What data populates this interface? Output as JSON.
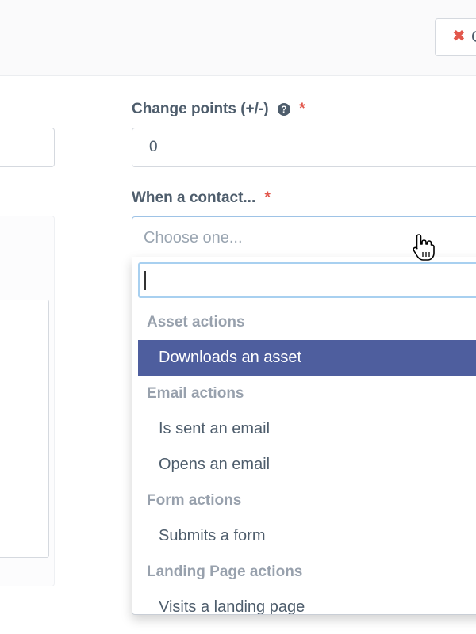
{
  "header": {
    "close_button": {
      "icon": "close-icon",
      "label": "C"
    }
  },
  "form": {
    "points": {
      "label": "Change points (+/-)",
      "help_icon": "question-circle-icon",
      "required_mark": "*",
      "value": "0"
    },
    "contact": {
      "label": "When a contact...",
      "required_mark": "*",
      "placeholder": "Choose one..."
    }
  },
  "dropdown": {
    "search_value": "",
    "groups": [
      {
        "label": "Asset actions",
        "options": [
          "Downloads an asset"
        ]
      },
      {
        "label": "Email actions",
        "options": [
          "Is sent an email",
          "Opens an email"
        ]
      },
      {
        "label": "Form actions",
        "options": [
          "Submits a form"
        ]
      },
      {
        "label": "Landing Page actions",
        "options": [
          "Visits a landing page"
        ]
      }
    ],
    "highlighted_option": "Downloads an asset"
  },
  "colors": {
    "accent": "#4e5e9e",
    "required": "#e2574c",
    "text": "#4e5d6c",
    "group_label": "#98a1ad"
  }
}
